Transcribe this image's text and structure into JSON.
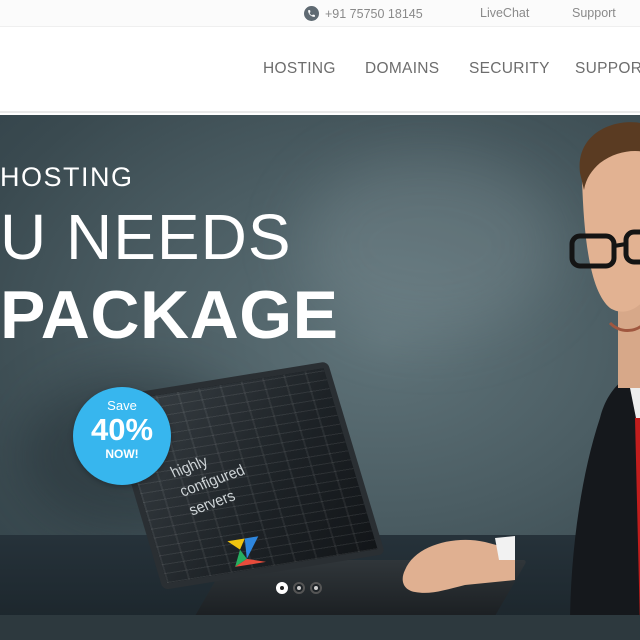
{
  "topbar": {
    "phone_icon": "phone-icon",
    "phone": "+91 75750 18145",
    "livechat": "LiveChat",
    "support": "Support"
  },
  "nav": {
    "items": [
      "HOSTING",
      "DOMAINS",
      "SECURITY",
      "SUPPORT"
    ]
  },
  "hero": {
    "line1": "HOSTING",
    "line2": "U NEEDS",
    "line3": "PACKAGE",
    "badge": {
      "top": "Save",
      "value": "40%",
      "bottom": "NOW!"
    },
    "screen_text": [
      "highly",
      "configured",
      "servers"
    ],
    "slider": {
      "count": 3,
      "active": 1
    }
  },
  "colors": {
    "badge": "#37b6ee",
    "hero_bg": "#4b5d63",
    "nav_text": "#6d6d6d"
  }
}
